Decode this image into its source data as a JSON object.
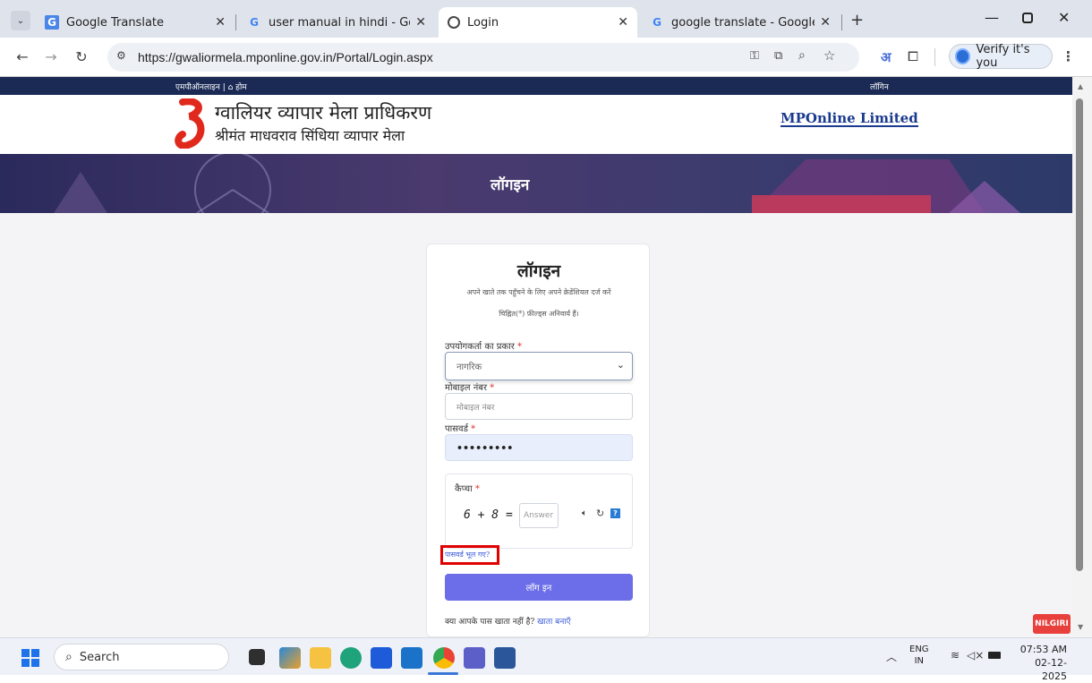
{
  "browser": {
    "tabs": [
      {
        "title": "Google Translate"
      },
      {
        "title": "user manual in hindi - Google S"
      },
      {
        "title": "Login"
      },
      {
        "title": "google translate - Google Searc"
      }
    ],
    "url": "https://gwaliormela.mponline.gov.in/Portal/Login.aspx",
    "translate_glyph": "अ",
    "verify_label": "Verify it's you"
  },
  "site": {
    "topstrip_left": "एमपीऑनलाइन | ⌂ होम",
    "topstrip_right": "लॉगिन",
    "org_title": "ग्वालियर व्यापार मेला प्राधिकरण",
    "org_subtitle": "श्रीमंत माधवराव सिंधिया व्यापार मेला",
    "partner_logo": "MPOnline Limited",
    "banner_title": "लॉगइन"
  },
  "login": {
    "title": "लॉगइन",
    "subtitle": "अपने खाते तक पहुँचने के लिए अपने क्रेडेंशियल दर्ज करें",
    "required_note": "चिह्नित(*) फ़ील्ड्स अनिवार्य हैं।",
    "user_type_label": "उपयोगकर्ता का प्रकार",
    "user_type_value": "नागरिक",
    "mobile_label": "मोबाइल नंबर",
    "mobile_placeholder": "मोबाइल नंबर",
    "password_label": "पासवर्ड",
    "password_value": "•••••••••",
    "captcha_label": "कैप्चा",
    "captcha_expr": "6 + 8 =",
    "captcha_placeholder": "Answer",
    "forgot_label": "पासवर्ड भूल गए?",
    "submit_label": "लॉग इन",
    "no_account_text": "क्या आपके पास खाता नहीं है?",
    "create_account_label": "खाता बनाएँ",
    "required_mark": "*"
  },
  "taskbar": {
    "search_label": "Search",
    "lang_top": "ENG",
    "lang_bottom": "IN",
    "time": "07:53 AM",
    "date": "02-12-2025",
    "nilgiri_badge": "NILGIRI"
  },
  "colors": {
    "tab_bg": "#dfe3eb",
    "primary_button": "#6b6ee8",
    "highlight_box": "#e00000",
    "navy": "#1a2a55"
  }
}
